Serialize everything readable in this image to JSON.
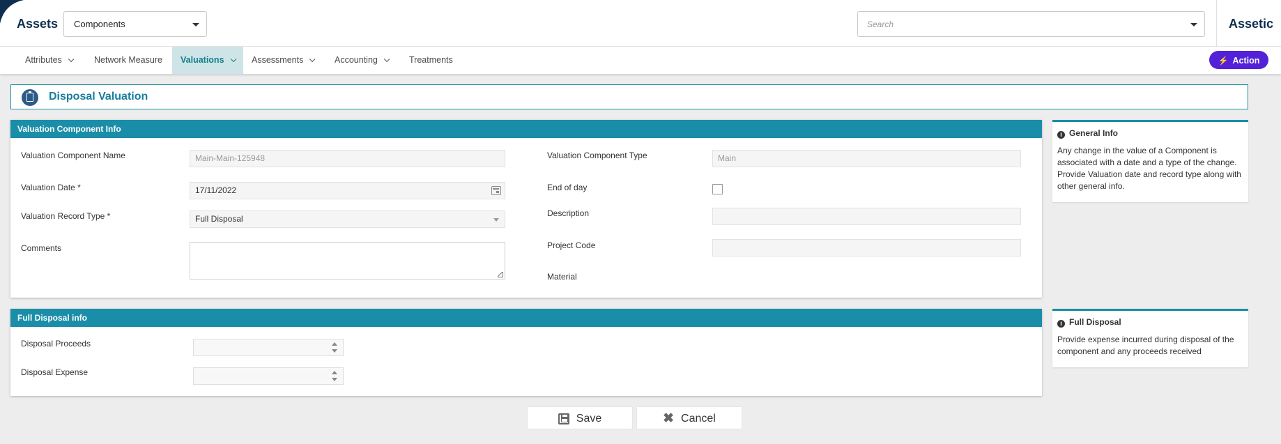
{
  "header": {
    "brand_left": "Assets",
    "module_select": "Components",
    "search_placeholder": "Search",
    "brand_right": "Assetic"
  },
  "nav": {
    "items": [
      {
        "label": "Attributes",
        "has_chevron": true
      },
      {
        "label": "Network Measure",
        "has_chevron": false
      },
      {
        "label": "Valuations",
        "has_chevron": true,
        "active": true
      },
      {
        "label": "Assessments",
        "has_chevron": true
      },
      {
        "label": "Accounting",
        "has_chevron": true
      },
      {
        "label": "Treatments",
        "has_chevron": false
      }
    ],
    "action_label": "Action"
  },
  "page": {
    "title": "Disposal Valuation"
  },
  "component_info": {
    "header": "Valuation Component Info",
    "name_label": "Valuation Component Name",
    "name_value": "Main-Main-125948",
    "date_label": "Valuation Date *",
    "date_value": "17/11/2022",
    "record_type_label": "Valuation Record Type *",
    "record_type_value": "Full Disposal",
    "comments_label": "Comments",
    "type_label": "Valuation Component Type",
    "type_value": "Main",
    "end_of_day_label": "End of day",
    "description_label": "Description",
    "project_code_label": "Project Code",
    "material_label": "Material"
  },
  "disposal_info": {
    "header": "Full Disposal info",
    "proceeds_label": "Disposal Proceeds",
    "expense_label": "Disposal Expense"
  },
  "general_info_card": {
    "title": "General Info",
    "body": "Any change in the value of a Component is associated with a date and a type of the change. Provide Valuation date and record type along with other general info."
  },
  "disposal_card": {
    "title": "Full Disposal",
    "body": "Provide expense incurred during disposal of the component and any proceeds received"
  },
  "buttons": {
    "save": "Save",
    "cancel": "Cancel"
  },
  "colors": {
    "brand": "#0e2e4f",
    "teal": "#1a8ea8",
    "action": "#5322d8",
    "active_tab_bg": "#cfe4e6"
  }
}
